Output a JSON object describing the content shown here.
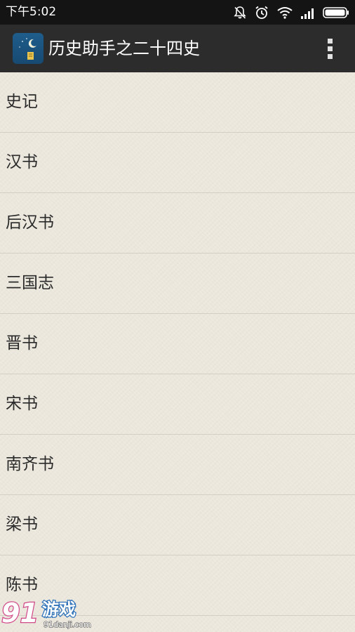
{
  "status_bar": {
    "time": "下午5:02",
    "icons": [
      "notification-off-icon",
      "alarm-icon",
      "wifi-icon",
      "signal-icon",
      "battery-icon"
    ]
  },
  "action_bar": {
    "title": "历史助手之二十四史",
    "app_icon": "moon-book-icon",
    "menu_icon": "overflow-menu-icon"
  },
  "list": {
    "items": [
      {
        "label": "史记"
      },
      {
        "label": "汉书"
      },
      {
        "label": "后汉书"
      },
      {
        "label": "三国志"
      },
      {
        "label": "晋书"
      },
      {
        "label": "宋书"
      },
      {
        "label": "南齐书"
      },
      {
        "label": "梁书"
      },
      {
        "label": "陈书"
      }
    ]
  },
  "watermark": {
    "number": "91",
    "brand": "游戏",
    "url": "91danji.com"
  },
  "colors": {
    "status_bar_bg": "#141414",
    "action_bar_bg": "#2c2c2c",
    "list_bg": "#ebe7dc",
    "divider": "#d3cfc4",
    "text": "#2a2a2a",
    "app_icon_blue": "#1f5d8c"
  }
}
